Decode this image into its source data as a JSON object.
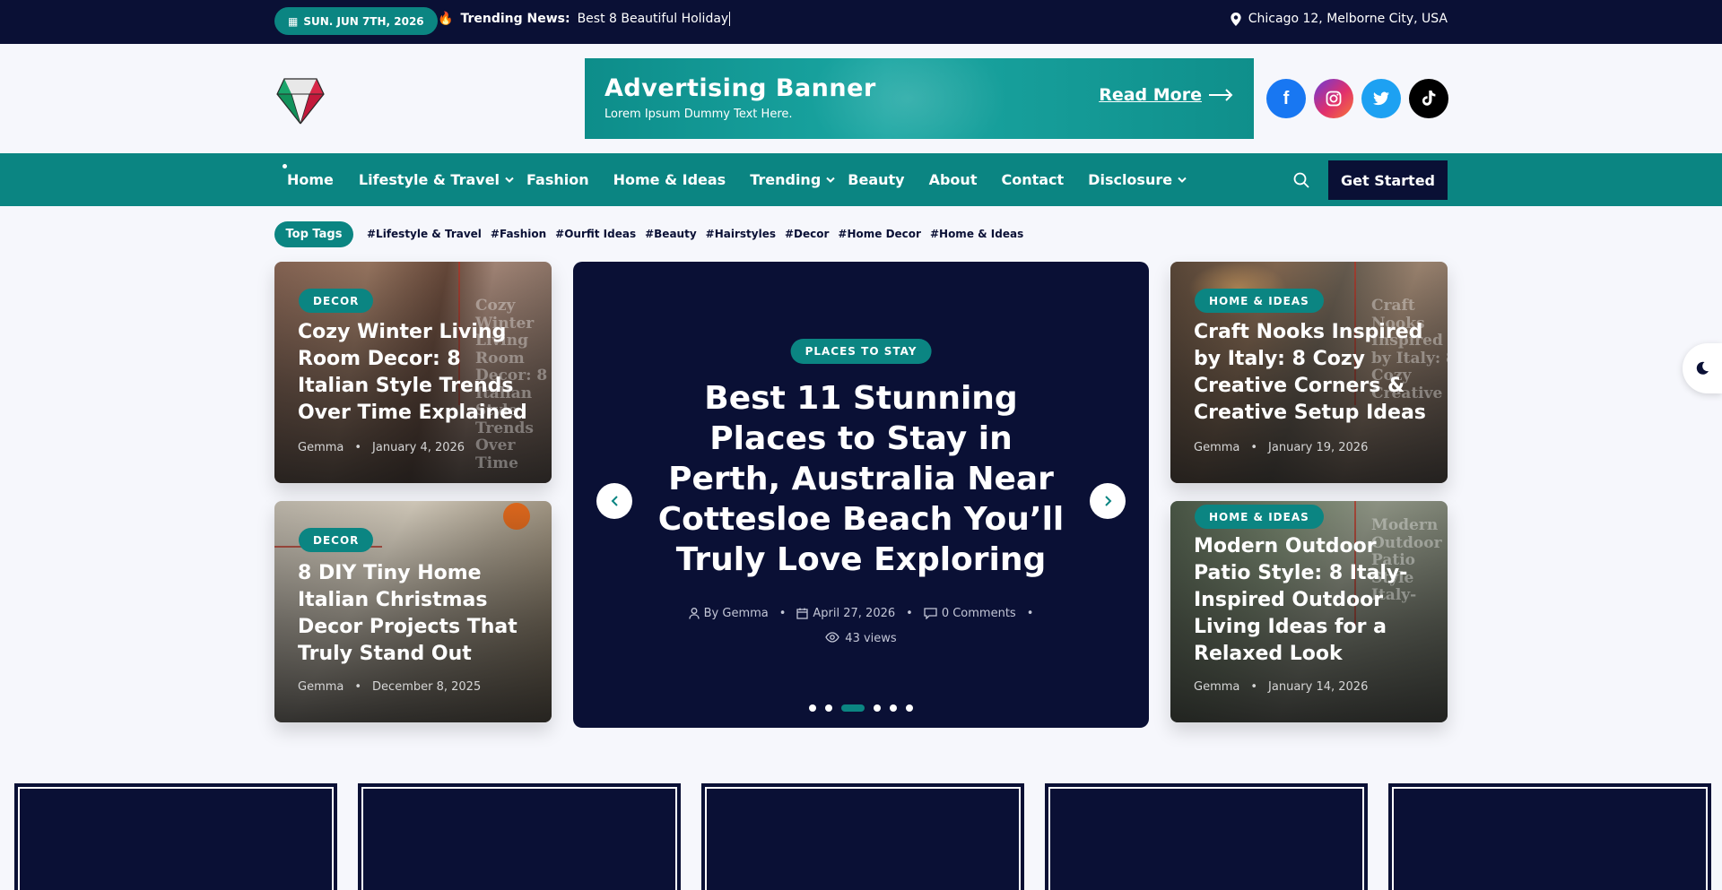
{
  "topbar": {
    "date": "SUN. JUN 7TH, 2026",
    "trending_label": "Trending News:",
    "trending_text": "Best 8 Beautiful Holiday",
    "location": "Chicago 12, Melborne City, USA"
  },
  "ad": {
    "title": "Advertising Banner",
    "subtitle": "Lorem Ipsum Dummy Text Here.",
    "link": "Read More"
  },
  "socials": [
    {
      "icon": "facebook-icon",
      "glyph": "f",
      "color": "#1877f2"
    },
    {
      "icon": "instagram-icon",
      "glyph": "◎",
      "color": "#e1306c"
    },
    {
      "icon": "twitter-icon",
      "glyph": "🐦",
      "color": "#1da1f2"
    },
    {
      "icon": "tiktok-icon",
      "glyph": "♪",
      "color": "#000000"
    }
  ],
  "nav": {
    "items": [
      {
        "label": "Home",
        "dropdown": false
      },
      {
        "label": "Lifestyle & Travel",
        "dropdown": true
      },
      {
        "label": "Fashion",
        "dropdown": false
      },
      {
        "label": "Home & Ideas",
        "dropdown": false
      },
      {
        "label": "Trending",
        "dropdown": true
      },
      {
        "label": "Beauty",
        "dropdown": false
      },
      {
        "label": "About",
        "dropdown": false
      },
      {
        "label": "Contact",
        "dropdown": false
      },
      {
        "label": "Disclosure",
        "dropdown": true
      }
    ],
    "cta": "Get Started"
  },
  "tags": {
    "label": "Top Tags",
    "items": [
      "#Lifestyle & Travel",
      "#Fashion",
      "#Ourfit Ideas",
      "#Beauty",
      "#Hairstyles",
      "#Decor",
      "#Home Decor",
      "#Home & Ideas"
    ]
  },
  "left_cards": [
    {
      "category": "DECOR",
      "title": "Cozy Winter Living Room Decor: 8 Italian Style Trends Over Time Explained",
      "author": "Gemma",
      "date": "January 4, 2026",
      "ghost": "Cozy Winter Living Room Decor: 8 Italian Style Trends Over Time"
    },
    {
      "category": "DECOR",
      "title": "8 DIY Tiny Home Italian Christmas Decor Projects That Truly Stand Out",
      "author": "Gemma",
      "date": "December 8, 2025",
      "ghost": ""
    }
  ],
  "right_cards": [
    {
      "category": "HOME & IDEAS",
      "title": "Craft Nooks Inspired by Italy: 8 Cozy Creative Corners & Creative Setup Ideas",
      "author": "Gemma",
      "date": "January 19, 2026",
      "ghost": "Craft Nooks Inspired by Italy: 8 Cozy Creative"
    },
    {
      "category": "HOME & IDEAS",
      "title": "Modern Outdoor Patio Style: 8 Italy-Inspired Outdoor Living Ideas for a Relaxed Look",
      "author": "Gemma",
      "date": "January 14, 2026",
      "ghost": "Modern Outdoor Patio Style Italy-"
    }
  ],
  "hero": {
    "category": "PLACES TO STAY",
    "title": "Best 11 Stunning Places to Stay in Perth, Australia Near Cottesloe Beach You’ll Truly Love Exploring",
    "author": "By Gemma",
    "date": "April 27, 2026",
    "comments": "0 Comments",
    "views": "43 views",
    "slide_count": 6,
    "active_slide": 3
  },
  "colors": {
    "accent": "#0b8582",
    "navy": "#0a1035"
  }
}
